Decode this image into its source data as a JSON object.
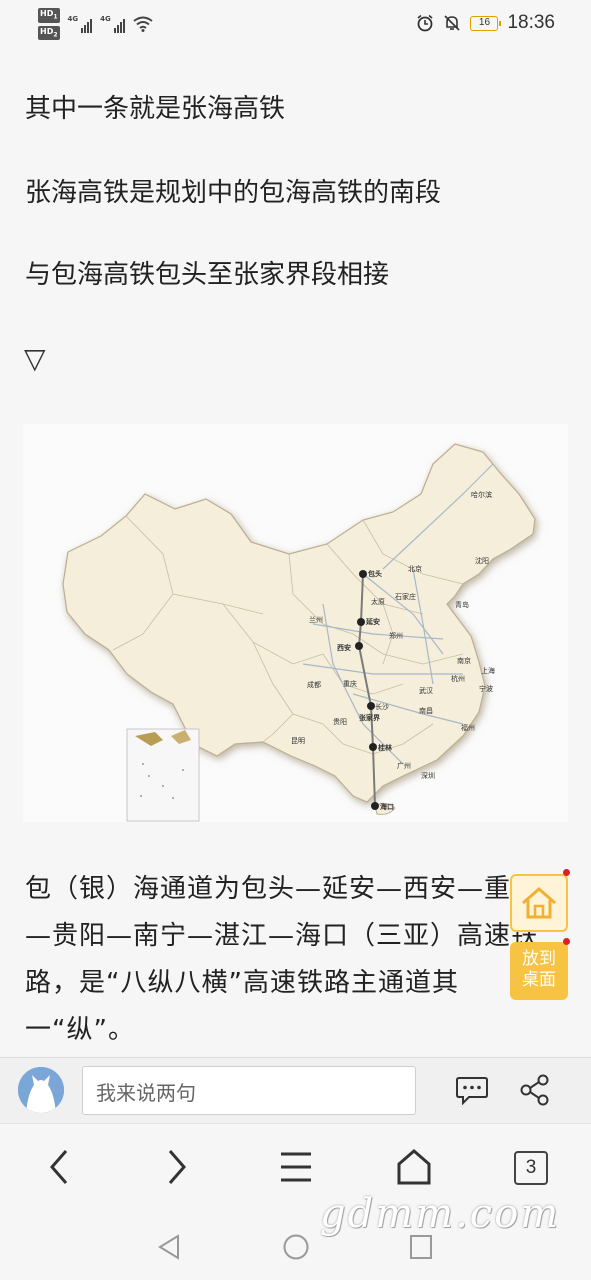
{
  "status_bar": {
    "hd1": "HD",
    "hd1_sub": "1",
    "hd2": "HD",
    "hd2_sub": "2",
    "net1": "4G",
    "net2": "4G",
    "icons": [
      "signal-icon",
      "signal-icon",
      "wifi-icon",
      "alarm-icon",
      "mute-icon"
    ],
    "battery_level": "16",
    "time": "18:36"
  },
  "article": {
    "paragraphs": [
      "其中一条就是张海高铁",
      "张海高铁是规划中的包海高铁的南段",
      "与包海高铁包头至张家界段相接"
    ],
    "triangle": "▽",
    "map": {
      "cities": [
        "哈尔滨",
        "沈阳",
        "北京",
        "包头",
        "石家庄",
        "太原",
        "青岛",
        "兰州",
        "延安",
        "郑州",
        "西安",
        "南京",
        "上海",
        "成都",
        "重庆",
        "武汉",
        "杭州",
        "宁波",
        "长沙",
        "张家界",
        "贵阳",
        "南昌",
        "昆明",
        "桂林",
        "福州",
        "广州",
        "深圳",
        "海口"
      ],
      "route_stops": [
        "包头",
        "延安",
        "西安",
        "张家界",
        "桂林",
        "海口"
      ]
    },
    "body": "包（银）海通道为包头—延安—西安—重庆—贵阳—南宁—湛江—海口（三亚）高速铁路，是“八纵八横”高速铁路主通道其一“纵”。"
  },
  "floating": {
    "home_icon": "home-icon",
    "desktop_label_1": "放到",
    "desktop_label_2": "桌面"
  },
  "comment_bar": {
    "placeholder": "我来说两句",
    "icons": [
      "comment-icon",
      "share-icon"
    ]
  },
  "nav": {
    "tab_count": "3",
    "icons": [
      "back-icon",
      "forward-icon",
      "menu-icon",
      "home-icon",
      "tabs-icon"
    ]
  },
  "watermark": "gdmm.com",
  "colors": {
    "accent_yellow": "#f7c343",
    "badge_red": "#e02020",
    "background": "#f6f6f6"
  }
}
